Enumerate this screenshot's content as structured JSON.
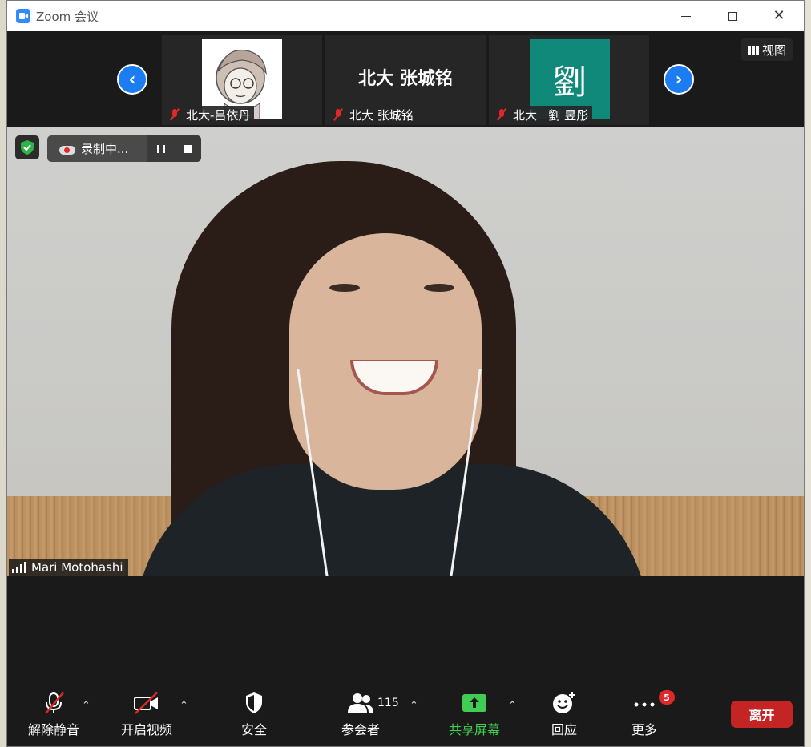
{
  "window": {
    "title": "Zoom 会议"
  },
  "gallery": {
    "view_label": "视图",
    "participants": [
      {
        "name": "北大-吕依丹",
        "muted": true,
        "avatar": "cartoon"
      },
      {
        "name": "北大 张城铭",
        "muted": true,
        "avatar_text": "北大 张城铭"
      },
      {
        "name": "北大   劉 昱彤",
        "muted": true,
        "avatar_text": "劉"
      }
    ]
  },
  "video": {
    "recording_label": "录制中...",
    "speaker_name": "Mari Motohashi"
  },
  "toolbar": {
    "unmute_label": "解除静音",
    "start_video_label": "开启视频",
    "security_label": "安全",
    "participants_label": "参会者",
    "participants_count": "115",
    "share_label": "共享屏幕",
    "reactions_label": "回应",
    "more_label": "更多",
    "more_badge": "5",
    "leave_label": "离开"
  },
  "colors": {
    "accent_blue": "#1c7cf1",
    "share_green": "#3fce53",
    "leave_red": "#c42424",
    "avatar_teal": "#10897a"
  }
}
